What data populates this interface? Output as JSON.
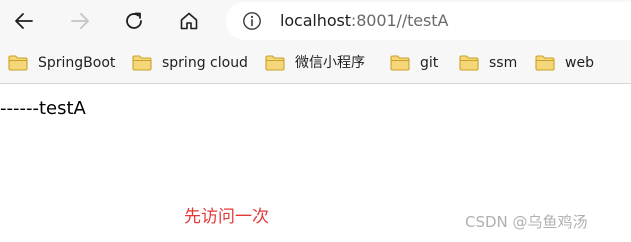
{
  "toolbar": {
    "back_icon": "back-arrow-icon",
    "forward_icon": "forward-arrow-icon",
    "reload_icon": "reload-icon",
    "home_icon": "home-icon",
    "info_icon": "info-icon",
    "url_host": "localhost",
    "url_rest": ":8001//testA"
  },
  "bookmarks": [
    {
      "label": "SpringBoot",
      "icon": "folder-icon"
    },
    {
      "label": "spring cloud",
      "icon": "folder-icon"
    },
    {
      "label": "微信小程序",
      "icon": "folder-icon"
    },
    {
      "label": "git",
      "icon": "folder-icon"
    },
    {
      "label": "ssm",
      "icon": "folder-icon"
    },
    {
      "label": "web",
      "icon": "folder-icon"
    }
  ],
  "content": {
    "text": "------testA"
  },
  "annotation": {
    "text": "先访问一次",
    "color": "#e03a3a"
  },
  "watermark": {
    "text": "CSDN @乌鱼鸡汤"
  }
}
